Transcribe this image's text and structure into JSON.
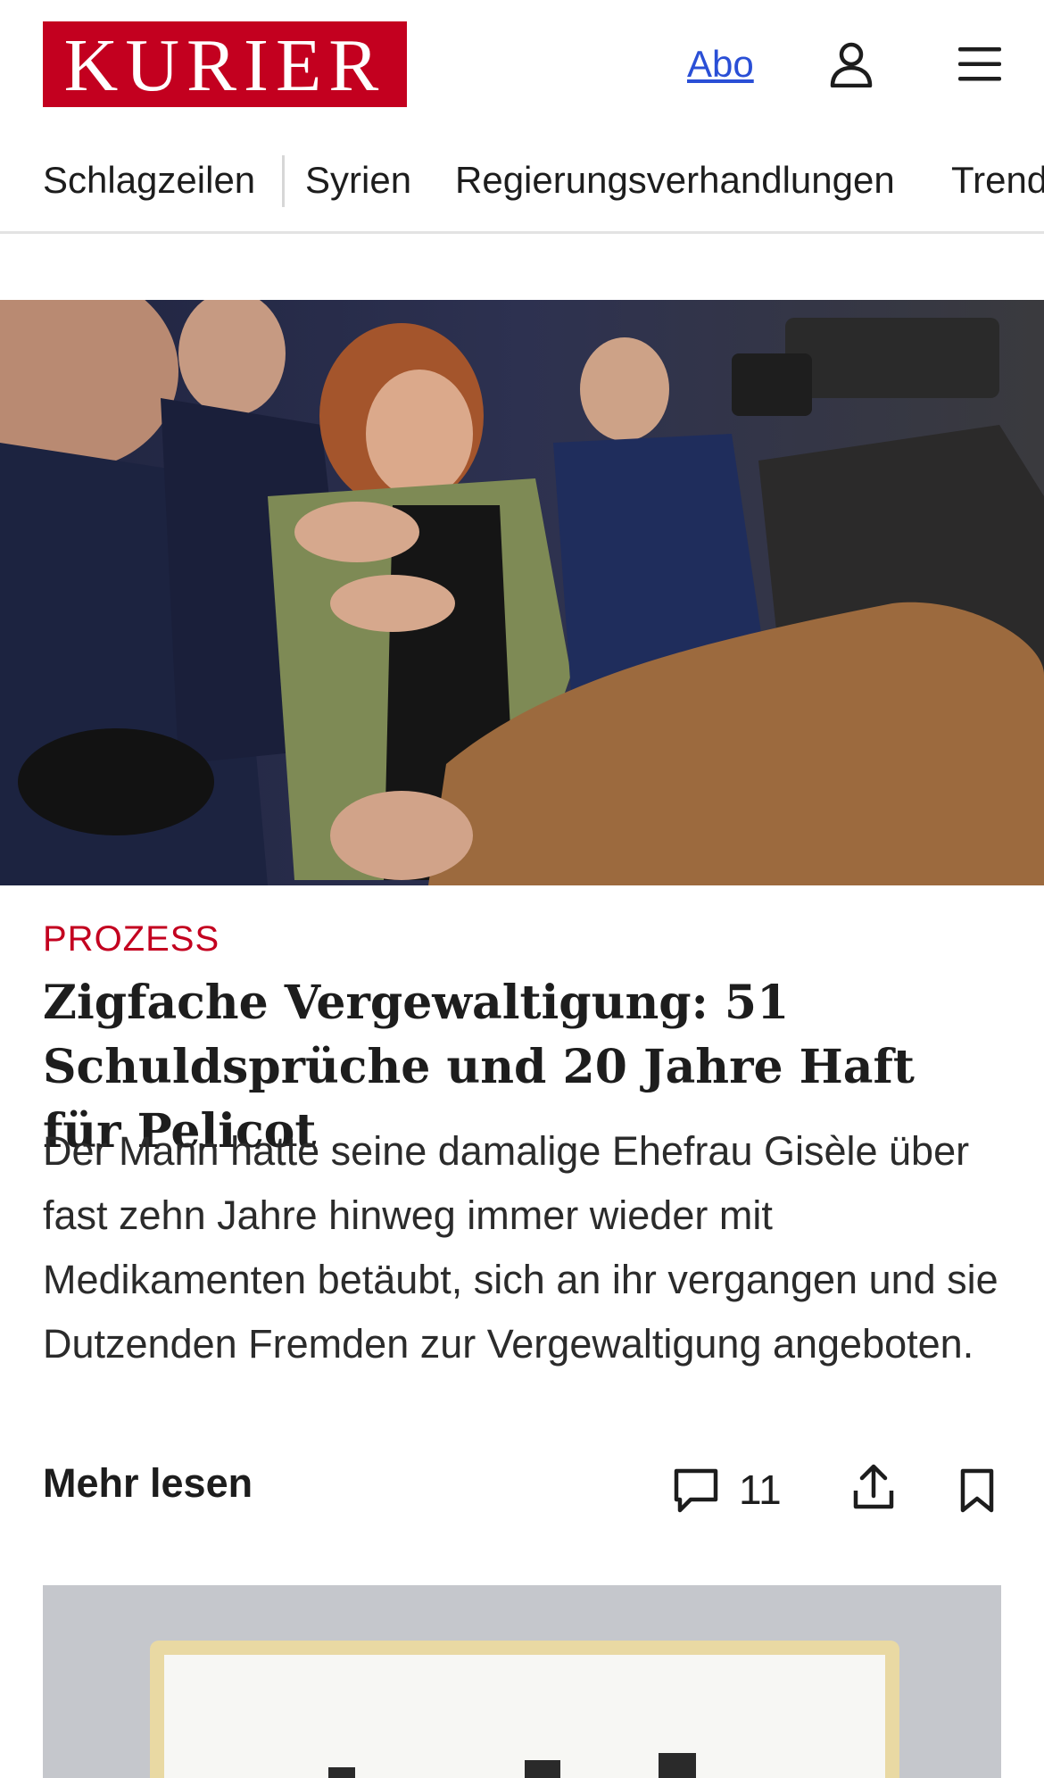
{
  "header": {
    "logo_text": "KURIER",
    "brand_color": "#c3001f",
    "abo_label": "Abo",
    "account_icon": "user-icon",
    "menu_icon": "hamburger-menu-icon"
  },
  "nav": {
    "items": [
      "Schlagzeilen",
      "Syrien",
      "Regierungsverhandlungen",
      "Trend"
    ]
  },
  "article": {
    "kicker": "PROZESS",
    "headline": "Zigfache Vergewaltigung: 51 Schuldsprüche und 20 Jahre Haft für Pelicot",
    "teaser": "Der Mann hatte seine damalige Ehefrau Gisèle über fast zehn Jahre hinweg immer wieder mit Medikamenten betäubt, sich an ihr vergangen und sie Dutzenden Fremden zur Vergewaltigung angeboten.",
    "more_label": "Mehr lesen",
    "comment_count": "11",
    "comment_icon": "comment-icon",
    "share_icon": "share-icon",
    "bookmark_icon": "bookmark-icon"
  }
}
